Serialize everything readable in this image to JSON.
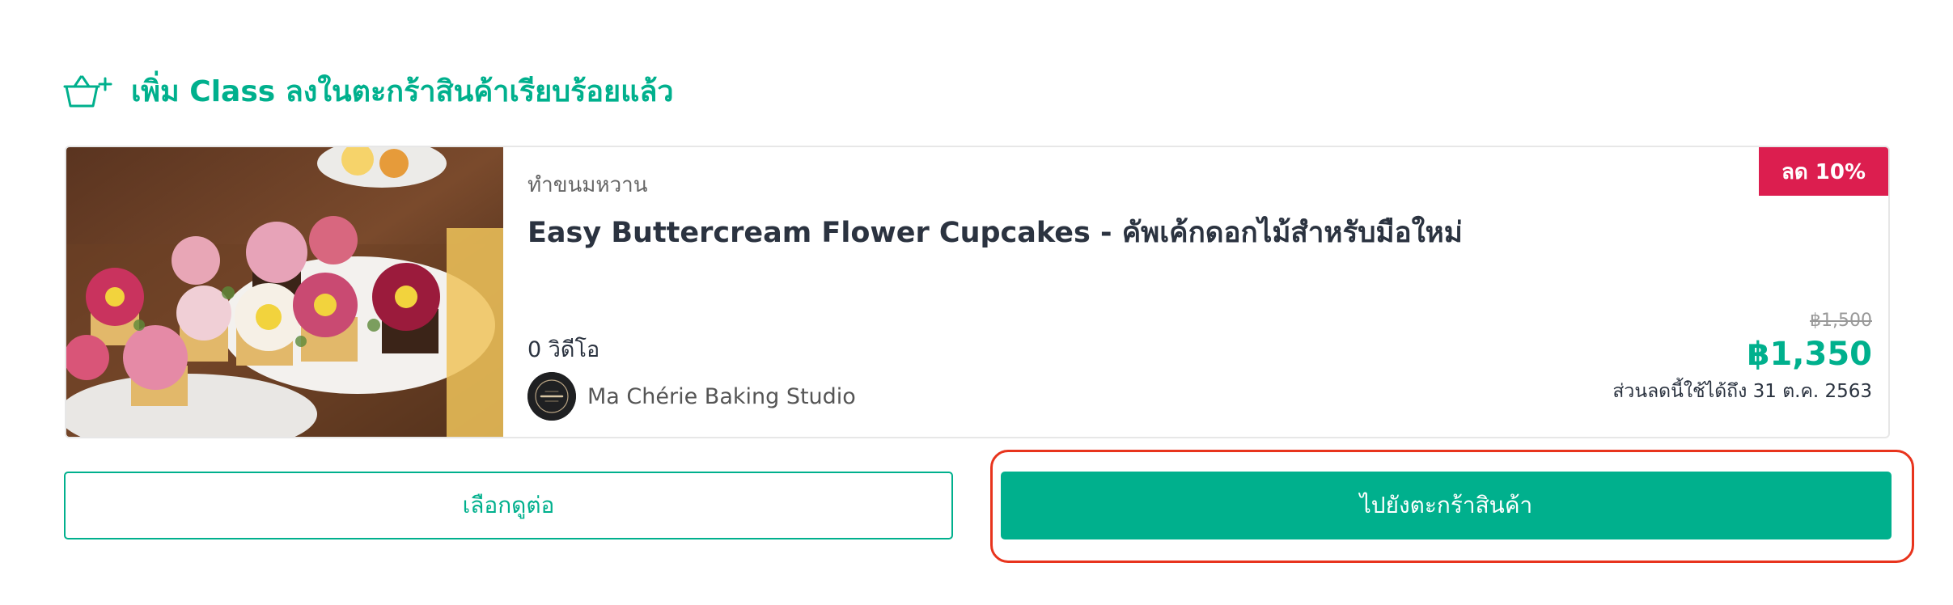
{
  "header": {
    "icon": "basket-plus-icon",
    "message": "เพิ่ม Class ลงในตะกร้าสินค้าเรียบร้อยแล้ว"
  },
  "course": {
    "category": "ทำขนมหวาน",
    "title": "Easy Buttercream Flower Cupcakes - คัพเค้กดอกไม้สำหรับมือใหม่",
    "discount_badge": "ลด 10%",
    "video_count": "0 วิดีโอ",
    "instructor_name": "Ma Chérie Baking Studio",
    "original_price": "฿1,500",
    "sale_price": "฿1,350",
    "discount_valid_until": "ส่วนลดนี้ใช้ได้ถึง 31 ต.ค. 2563"
  },
  "actions": {
    "continue_browsing": "เลือกดูต่อ",
    "go_to_cart": "ไปยังตะกร้าสินค้า"
  },
  "colors": {
    "brand_green": "#00b08d",
    "badge_red": "#dc1e4f",
    "highlight_ring": "#e8341d",
    "title_text": "#2b3340"
  }
}
